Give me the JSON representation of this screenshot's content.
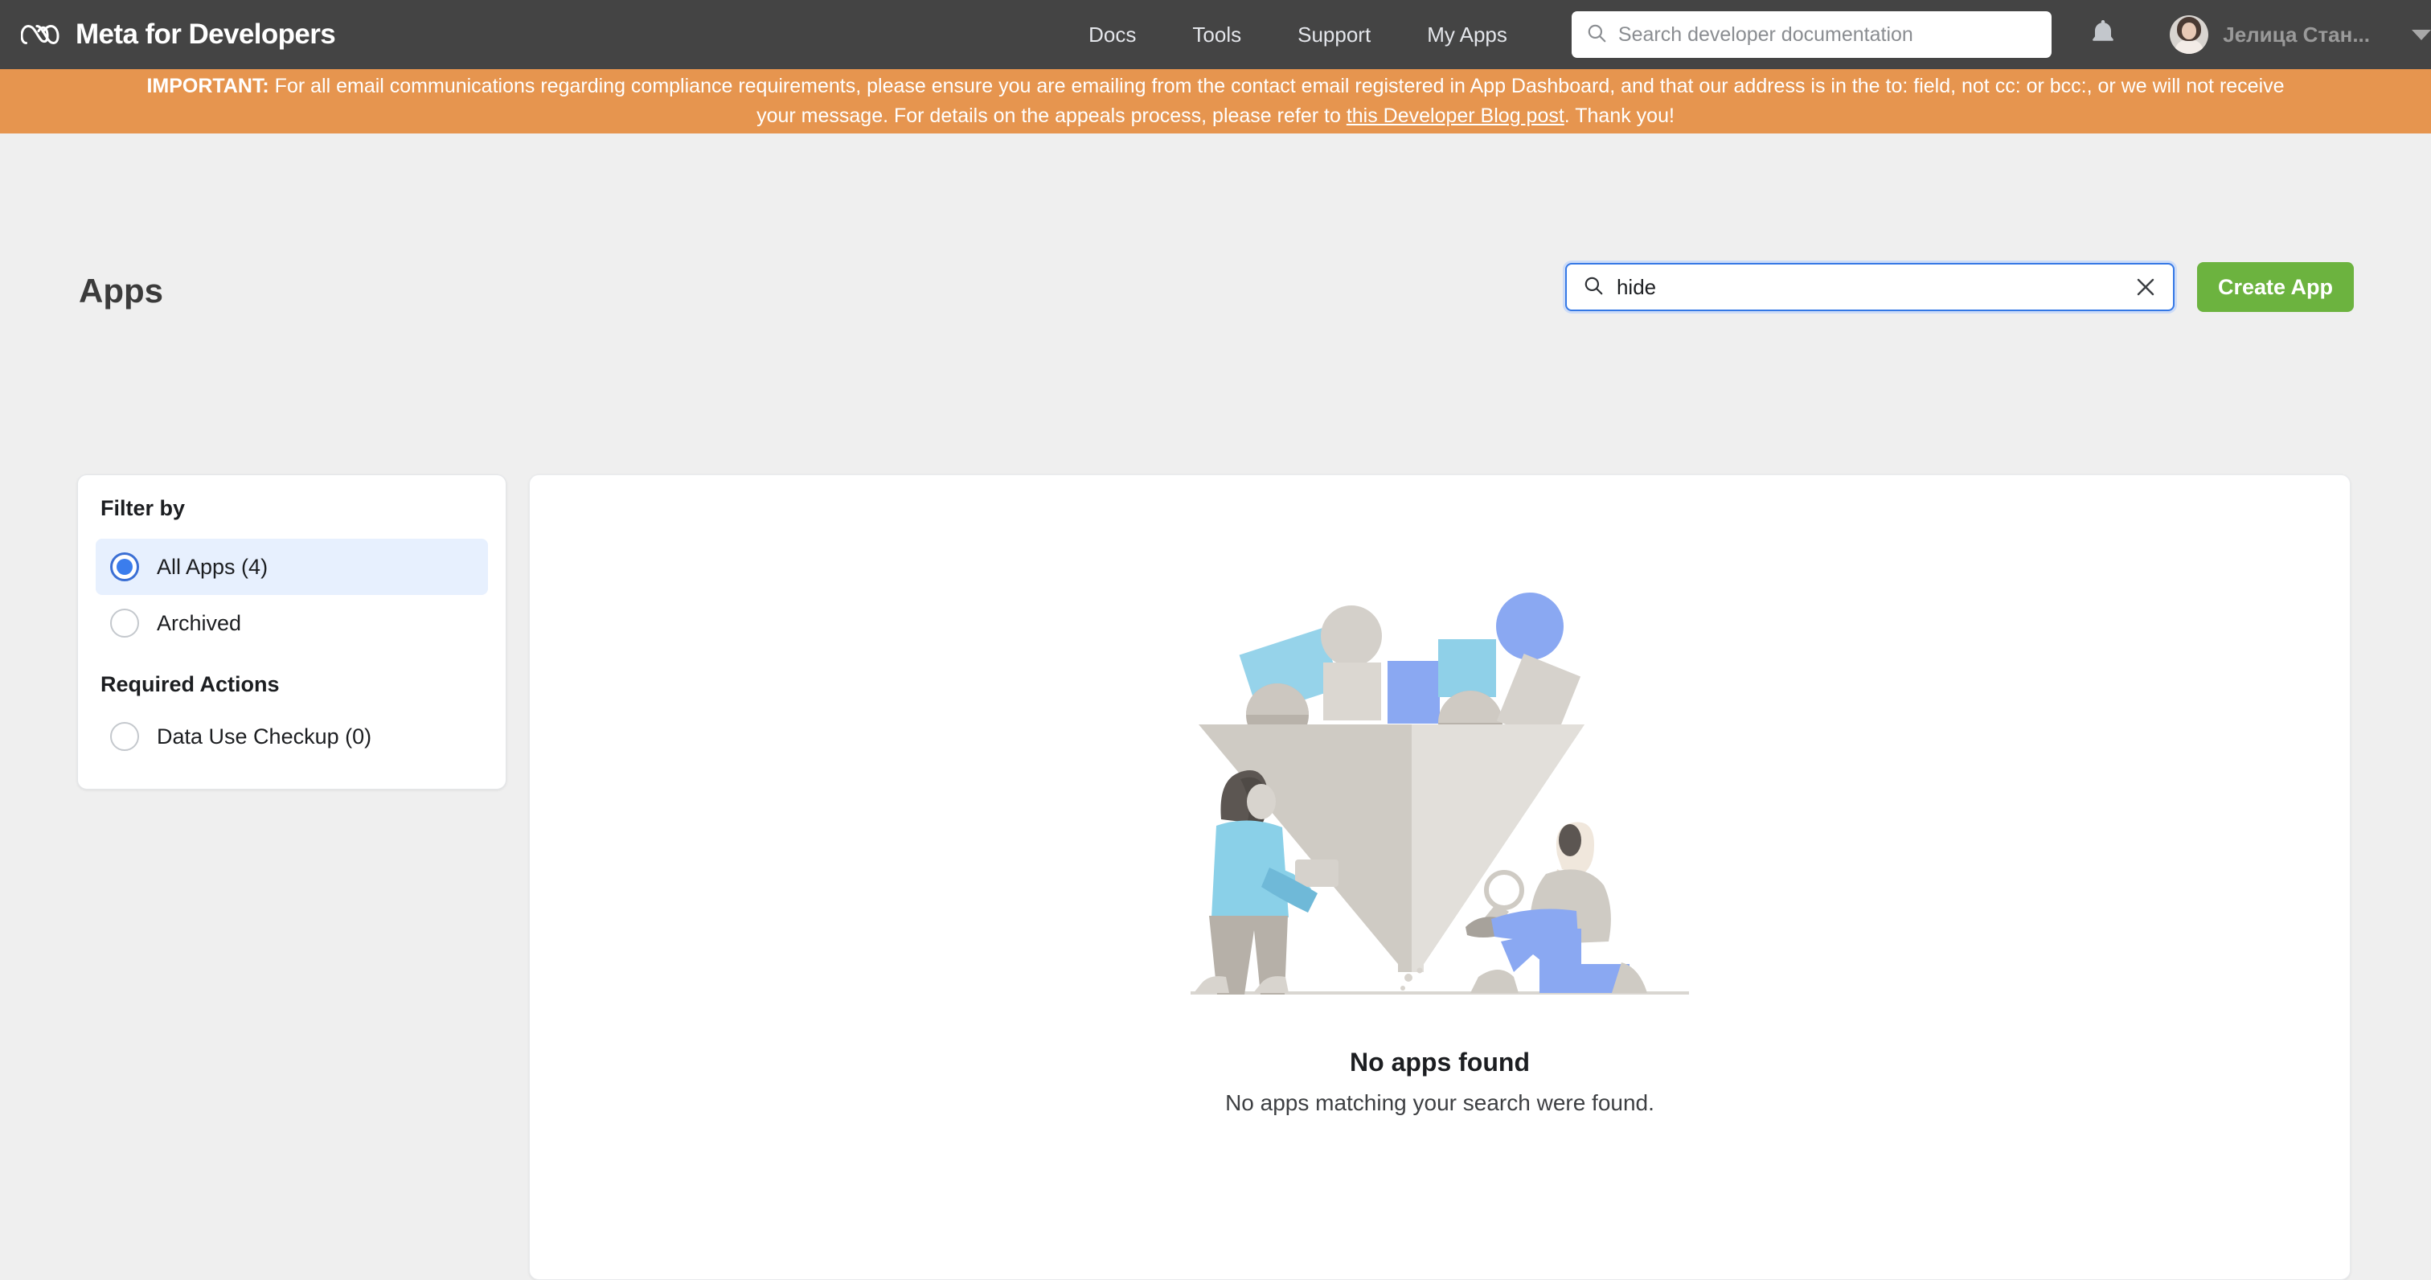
{
  "topnav": {
    "brand": "Meta for Developers",
    "brand_logo_icon": "meta-infinity-logo",
    "links": [
      {
        "label": "Docs"
      },
      {
        "label": "Tools"
      },
      {
        "label": "Support"
      },
      {
        "label": "My Apps"
      }
    ],
    "search": {
      "placeholder": "Search developer documentation",
      "icon": "search-icon",
      "value": ""
    },
    "notifications_icon": "bell-icon",
    "profile": {
      "name": "Јелица Стан...",
      "avatar_icon": "user-avatar",
      "caret_icon": "chevron-down-icon"
    },
    "bg_color": "#444444"
  },
  "banner": {
    "label": "IMPORTANT:",
    "text_part1": " For all email communications regarding compliance requirements, please ensure you are emailing from the contact email registered in App Dashboard, and that our address is in the to: field, not cc: or bcc:, or we will not receive your message. For details on the appeals process, please refer to ",
    "link_text": "this Developer Blog post",
    "text_part2": ". Thank you!",
    "bg_color": "#e6954f"
  },
  "page": {
    "title": "Apps",
    "search": {
      "value": "hide",
      "search_icon": "search-icon",
      "clear_icon": "close-icon"
    },
    "create_button": "Create App",
    "create_button_color": "#6cb33f"
  },
  "filter_panel": {
    "heading": "Filter by",
    "options": [
      {
        "label": "All Apps (4)",
        "selected": true
      },
      {
        "label": "Archived",
        "selected": false
      }
    ],
    "second_heading": "Required Actions",
    "required_actions": [
      {
        "label": "Data Use Checkup (0)",
        "selected": false
      }
    ],
    "selected_bg": "#e7f0fe",
    "radio_color": "#3b7ded"
  },
  "empty_state": {
    "illustration": "funnel-search-illustration",
    "title": "No apps found",
    "subtitle": "No apps matching your search were found."
  }
}
